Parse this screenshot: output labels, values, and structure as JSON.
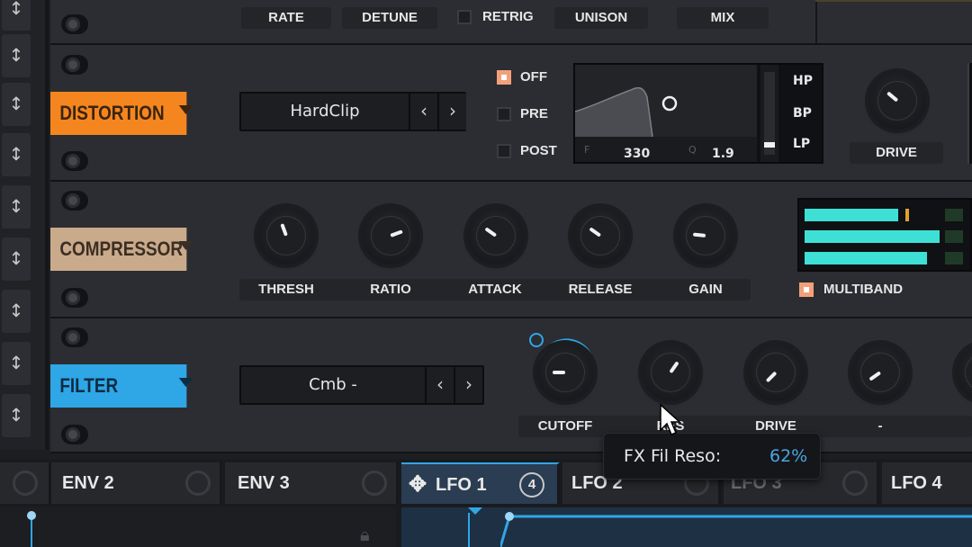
{
  "top_row": {
    "labels": [
      "RATE",
      "DETUNE",
      "RETRIG",
      "UNISON",
      "MIX"
    ]
  },
  "distortion": {
    "title": "DISTORTION",
    "type_value": "HardClip",
    "prev": "‹",
    "next": "›",
    "routing": [
      {
        "label": "OFF",
        "checked": true
      },
      {
        "label": "PRE",
        "checked": false
      },
      {
        "label": "POST",
        "checked": false
      }
    ],
    "filter_graph": {
      "f_label": "F",
      "f_value": "330",
      "q_label": "Q",
      "q_value": "1.9",
      "modes": [
        "HP",
        "BP",
        "LP"
      ]
    },
    "drive_label": "DRIVE"
  },
  "compressor": {
    "title": "COMPRESSOR",
    "knobs": [
      "THRESH",
      "RATIO",
      "ATTACK",
      "RELEASE",
      "GAIN"
    ],
    "multiband_label": "MULTIBAND",
    "multiband_checked": true
  },
  "filter": {
    "title": "FILTER",
    "type_value": "Cmb -",
    "prev": "‹",
    "next": "›",
    "knobs": [
      "CUTOFF",
      "RES",
      "DRIVE",
      "-"
    ]
  },
  "tooltip": {
    "label": "FX Fil Reso:",
    "value": "62%"
  },
  "bottom_tabs": [
    {
      "label": "ENV 2"
    },
    {
      "label": "ENV 3"
    },
    {
      "label": "LFO 1",
      "badge": "4"
    },
    {
      "label": "LFO 2"
    },
    {
      "label": "LFO 3"
    },
    {
      "label": "LFO 4"
    }
  ],
  "colors": {
    "distortion": "#f5861f",
    "compressor": "#c9aa8a",
    "filter": "#2fa6e6",
    "accent_cyan": "#3ee0d6",
    "check_on": "#f3a07a"
  }
}
